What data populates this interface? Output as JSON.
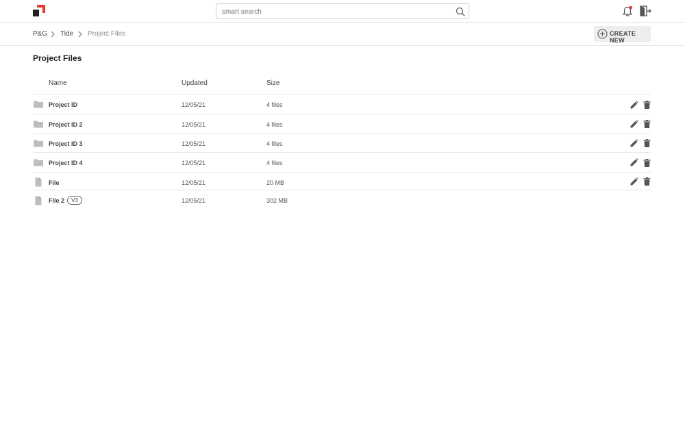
{
  "header": {
    "search": {
      "placeholder": "smart search",
      "value": ""
    },
    "accent_color": "#e53935"
  },
  "breadcrumb": {
    "items": [
      {
        "label": "P&G"
      },
      {
        "label": "Tide"
      },
      {
        "label": "Project Files"
      }
    ]
  },
  "actions": {
    "create_label": "CREATE NEW"
  },
  "page": {
    "title": "Project Files"
  },
  "table": {
    "columns": {
      "name": "Name",
      "updated": "Updated",
      "size": "Size"
    },
    "rows": [
      {
        "type": "folder",
        "icon": "folder-icon",
        "name": "Project ID",
        "updated": "12/05/21",
        "size": "4 files",
        "actions": [
          "edit",
          "delete"
        ]
      },
      {
        "type": "folder",
        "icon": "folder-icon",
        "name": "Project ID 2",
        "updated": "12/05/21",
        "size": "4 files",
        "actions": [
          "edit",
          "delete"
        ]
      },
      {
        "type": "folder",
        "icon": "folder-icon",
        "name": "Project ID 3",
        "updated": "12/05/21",
        "size": "4 files",
        "actions": [
          "edit",
          "delete"
        ]
      },
      {
        "type": "folder",
        "icon": "folder-icon",
        "name": "Project ID 4",
        "updated": "12/05/21",
        "size": "4 files",
        "actions": [
          "edit",
          "delete"
        ]
      },
      {
        "type": "file",
        "icon": "file-icon",
        "name": "File",
        "updated": "12/05/21",
        "size": "20 MB",
        "actions": [
          "edit",
          "delete"
        ]
      },
      {
        "type": "file",
        "icon": "file-icon",
        "name": "File 2",
        "version": "V3",
        "updated": "12/05/21",
        "size": "302 MB",
        "actions": []
      }
    ]
  }
}
